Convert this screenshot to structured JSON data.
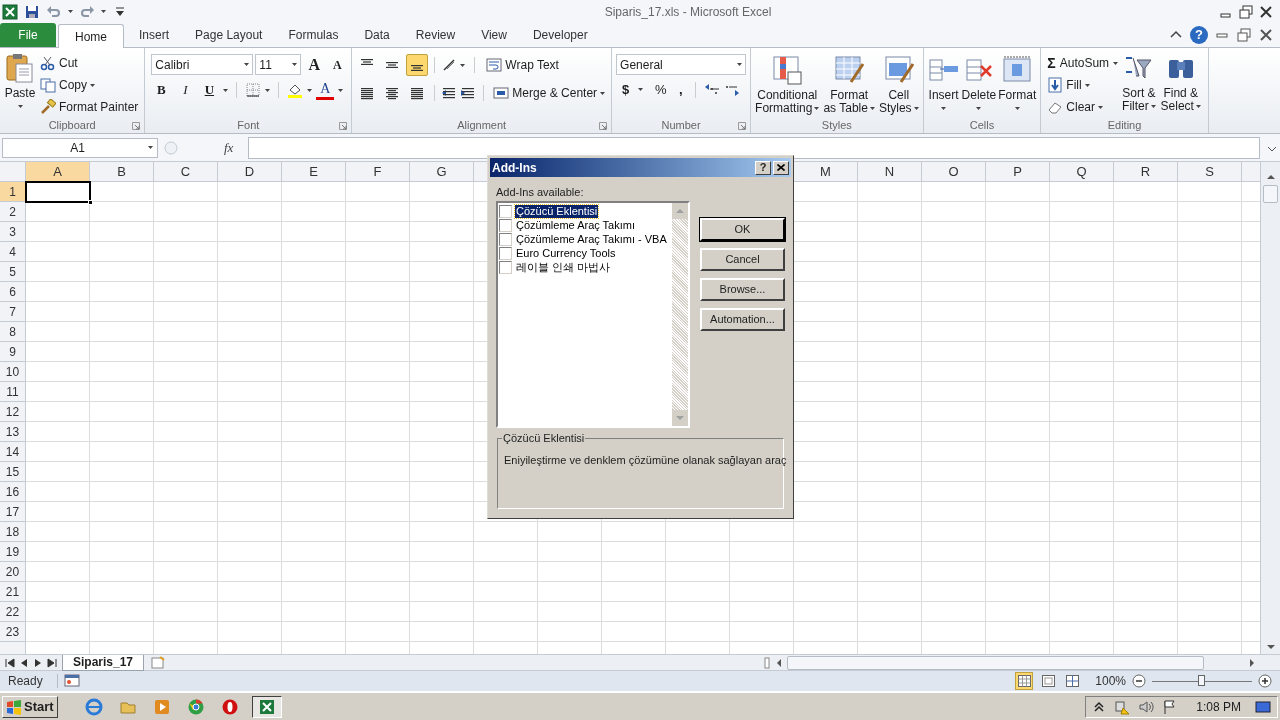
{
  "window": {
    "title": "Siparis_17.xls - Microsoft Excel"
  },
  "tabs": [
    {
      "label": "File",
      "kind": "file",
      "selected": false
    },
    {
      "label": "Home",
      "kind": "tab",
      "selected": true
    },
    {
      "label": "Insert",
      "kind": "tab",
      "selected": false
    },
    {
      "label": "Page Layout",
      "kind": "tab",
      "selected": false
    },
    {
      "label": "Formulas",
      "kind": "tab",
      "selected": false
    },
    {
      "label": "Data",
      "kind": "tab",
      "selected": false
    },
    {
      "label": "Review",
      "kind": "tab",
      "selected": false
    },
    {
      "label": "View",
      "kind": "tab",
      "selected": false
    },
    {
      "label": "Developer",
      "kind": "tab",
      "selected": false
    }
  ],
  "help": "?",
  "ribbon": {
    "clipboard": {
      "label": "Clipboard",
      "paste": "Paste",
      "cut": "Cut",
      "copy": "Copy",
      "format_painter": "Format Painter"
    },
    "font": {
      "label": "Font",
      "font_name": "Calibri",
      "font_size": "11",
      "grow": "A",
      "shrink": "A",
      "bold": "B",
      "italic": "I",
      "underline": "U",
      "font_color": "A"
    },
    "alignment": {
      "label": "Alignment",
      "vertical_align": [
        {
          "selected": false
        },
        {
          "selected": false
        },
        {
          "selected": true
        }
      ],
      "wrap_text": "Wrap Text",
      "merge_center": "Merge & Center"
    },
    "number": {
      "label": "Number",
      "format": "General",
      "currency": "$",
      "percent": "%",
      "comma": ","
    },
    "styles": {
      "label": "Styles",
      "buttons": [
        {
          "kind": "conditional",
          "lines": [
            "Conditional",
            "Formatting"
          ]
        },
        {
          "kind": "table",
          "lines": [
            "Format",
            "as Table"
          ]
        },
        {
          "kind": "cellstyles",
          "lines": [
            "Cell",
            "Styles"
          ]
        }
      ]
    },
    "cells": {
      "label": "Cells",
      "buttons": [
        {
          "kind": "insert",
          "label": "Insert"
        },
        {
          "kind": "delete",
          "label": "Delete"
        },
        {
          "kind": "format",
          "label": "Format"
        }
      ]
    },
    "editing": {
      "label": "Editing",
      "autosum_symbol": "Σ",
      "autosum": "AutoSum",
      "fill": "Fill",
      "clear": "Clear",
      "sort_filter": [
        "Sort &",
        "Filter"
      ],
      "find_select": [
        "Find &",
        "Select"
      ]
    }
  },
  "formula_bar": {
    "name_box": "A1",
    "fx": "fx"
  },
  "grid": {
    "columns_left": [
      {
        "label": "A",
        "selected": true
      },
      {
        "label": "B",
        "selected": false
      },
      {
        "label": "C",
        "selected": false
      },
      {
        "label": "D",
        "selected": false
      },
      {
        "label": "E",
        "selected": false
      },
      {
        "label": "F",
        "selected": false
      },
      {
        "label": "G",
        "selected": false
      }
    ],
    "columns_right": [
      {
        "label": "M",
        "selected": false
      },
      {
        "label": "N",
        "selected": false
      },
      {
        "label": "O",
        "selected": false
      },
      {
        "label": "P",
        "selected": false
      },
      {
        "label": "Q",
        "selected": false
      },
      {
        "label": "R",
        "selected": false
      },
      {
        "label": "S",
        "selected": false
      }
    ],
    "rows": [
      {
        "label": "1",
        "selected": true
      },
      {
        "label": "2",
        "selected": false
      },
      {
        "label": "3",
        "selected": false
      },
      {
        "label": "4",
        "selected": false
      },
      {
        "label": "5",
        "selected": false
      },
      {
        "label": "6",
        "selected": false
      },
      {
        "label": "7",
        "selected": false
      },
      {
        "label": "8",
        "selected": false
      },
      {
        "label": "9",
        "selected": false
      },
      {
        "label": "10",
        "selected": false
      },
      {
        "label": "11",
        "selected": false
      },
      {
        "label": "12",
        "selected": false
      },
      {
        "label": "13",
        "selected": false
      },
      {
        "label": "14",
        "selected": false
      },
      {
        "label": "15",
        "selected": false
      },
      {
        "label": "16",
        "selected": false
      },
      {
        "label": "17",
        "selected": false
      },
      {
        "label": "18",
        "selected": false
      },
      {
        "label": "19",
        "selected": false
      },
      {
        "label": "20",
        "selected": false
      },
      {
        "label": "21",
        "selected": false
      },
      {
        "label": "22",
        "selected": false
      },
      {
        "label": "23",
        "selected": false
      }
    ]
  },
  "dialog": {
    "title": "Add-Ins",
    "help": "?",
    "list_label": "Add-Ins available:",
    "items": [
      {
        "label": "Çözücü Eklentisi",
        "checked": false,
        "selected": true
      },
      {
        "label": "Çözümleme Araç Takımı",
        "checked": false,
        "selected": false
      },
      {
        "label": "Çözümleme Araç Takımı - VBA",
        "checked": false,
        "selected": false
      },
      {
        "label": "Euro Currency Tools",
        "checked": false,
        "selected": false
      },
      {
        "label": "레이블 인쇄 마법사",
        "checked": false,
        "selected": false
      }
    ],
    "buttons": [
      {
        "label": "OK",
        "default": true
      },
      {
        "label": "Cancel",
        "default": false
      },
      {
        "label": "Browse...",
        "default": false
      },
      {
        "label": "Automation...",
        "default": false
      }
    ],
    "description_title": "Çözücü Eklentisi",
    "description": "Eniyileştirme ve denklem çözümüne olanak sağlayan araç"
  },
  "sheet_tabs": [
    {
      "label": "Siparis_17",
      "selected": true
    }
  ],
  "status_bar": {
    "text": "Ready",
    "views": [
      {
        "kind": "normal",
        "selected": true
      },
      {
        "kind": "layout",
        "selected": false
      },
      {
        "kind": "pagebreak",
        "selected": false
      }
    ],
    "zoom": "100%",
    "zoom_slider": {
      "level": 0.5
    }
  },
  "taskbar": {
    "start": "Start",
    "apps": [
      {
        "kind": "ie",
        "selected": false
      },
      {
        "kind": "folder",
        "selected": false
      },
      {
        "kind": "media",
        "selected": false
      },
      {
        "kind": "chrome",
        "selected": false
      },
      {
        "kind": "opera",
        "selected": false
      },
      {
        "kind": "excel",
        "selected": true
      }
    ],
    "time": "1:08 PM"
  }
}
